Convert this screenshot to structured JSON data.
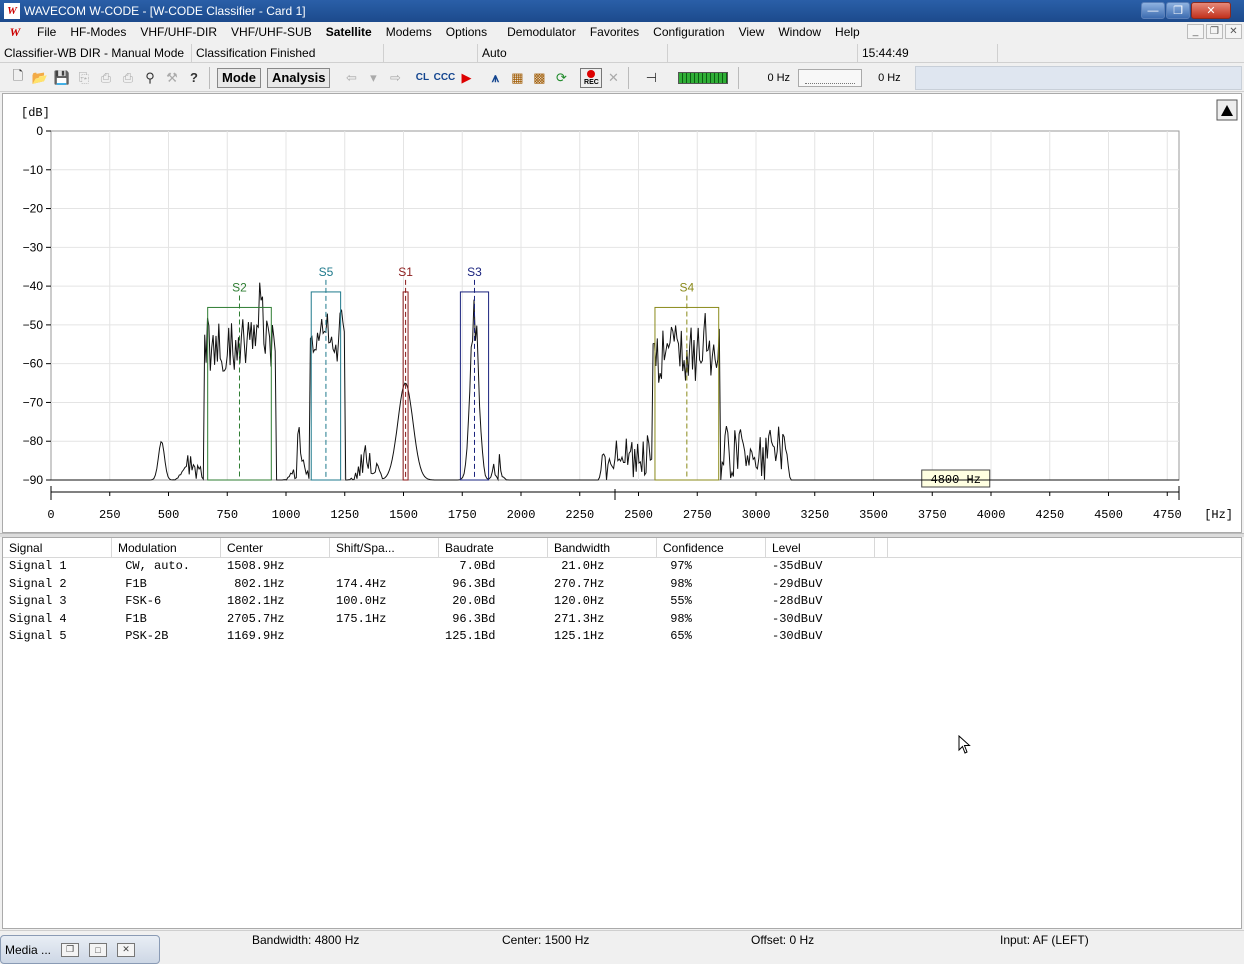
{
  "window": {
    "title": "WAVECOM W-CODE - [W-CODE Classifier  - Card 1]",
    "app_icon": "W-CODE"
  },
  "menu": [
    "File",
    "HF-Modes",
    "VHF/UHF-DIR",
    "VHF/UHF-SUB",
    "Satellite",
    "Modems",
    "Options",
    "Demodulator",
    "Favorites",
    "Configuration",
    "View",
    "Window",
    "Help"
  ],
  "status_top": {
    "mode": "Classifier-WB DIR - Manual Mode",
    "state": "Classification Finished",
    "auto": "Auto",
    "time": "15:44:49"
  },
  "toolbar": {
    "mode_label": "Mode",
    "analysis_label": "Analysis",
    "cl_label": "CL",
    "ccc_label": "CCC",
    "rec_label": "REC",
    "freq_left": "0 Hz",
    "freq_right": "0 Hz"
  },
  "spectrum": {
    "y_unit": "[dB]",
    "x_unit": "[Hz]",
    "y_ticks": [
      "0",
      "−10",
      "−20",
      "−30",
      "−40",
      "−50",
      "−60",
      "−70",
      "−80",
      "−90"
    ],
    "x_ticks": [
      "0",
      "250",
      "500",
      "750",
      "1000",
      "1250",
      "1500",
      "1750",
      "2000",
      "2250",
      "2500",
      "2750",
      "3000",
      "3250",
      "3500",
      "3750",
      "4000",
      "4250",
      "4500",
      "4750"
    ],
    "bandwidth_badge": "4800 Hz",
    "y_range": [
      -90,
      0
    ],
    "x_range": [
      0,
      4800
    ],
    "markers": [
      {
        "label": "S2",
        "color": "#2e7d32",
        "center": 802.1,
        "bandwidth": 270.7,
        "top_db": -45.5
      },
      {
        "label": "S5",
        "color": "#1f7a8c",
        "center": 1169.9,
        "bandwidth": 125.1,
        "top_db": -41.5
      },
      {
        "label": "S1",
        "color": "#8b1a1a",
        "center": 1508.9,
        "bandwidth": 21.0,
        "top_db": -41.5
      },
      {
        "label": "S3",
        "color": "#1a237e",
        "center": 1802.1,
        "bandwidth": 120.0,
        "top_db": -41.5
      },
      {
        "label": "S4",
        "color": "#8a8a1a",
        "center": 2705.7,
        "bandwidth": 271.3,
        "top_db": -45.5
      }
    ]
  },
  "table": {
    "columns": [
      "Signal",
      "Modulation",
      "Center",
      "Shift/Spa...",
      "Baudrate",
      "Bandwidth",
      "Confidence",
      "Level"
    ],
    "rows": [
      [
        "Signal 1",
        " CW, auto.",
        "1508.9Hz",
        "",
        "  7.0Bd",
        " 21.0Hz",
        " 97%",
        "-35dBuV"
      ],
      [
        "Signal 2",
        " F1B",
        " 802.1Hz",
        "174.4Hz",
        " 96.3Bd",
        "270.7Hz",
        " 98%",
        "-29dBuV"
      ],
      [
        "Signal 3",
        " FSK-6",
        "1802.1Hz",
        "100.0Hz",
        " 20.0Bd",
        "120.0Hz",
        " 55%",
        "-28dBuV"
      ],
      [
        "Signal 4",
        " F1B",
        "2705.7Hz",
        "175.1Hz",
        " 96.3Bd",
        "271.3Hz",
        " 98%",
        "-30dBuV"
      ],
      [
        "Signal 5",
        " PSK-2B",
        "1169.9Hz",
        "",
        "125.1Bd",
        "125.1Hz",
        " 65%",
        "-30dBuV"
      ]
    ]
  },
  "status_bottom": {
    "bandwidth": "Bandwidth: 4800 Hz",
    "center": "Center: 1500 Hz",
    "offset": "Offset: 0 Hz",
    "input": "Input: AF (LEFT)"
  },
  "taskbar": {
    "label": "Media ..."
  }
}
